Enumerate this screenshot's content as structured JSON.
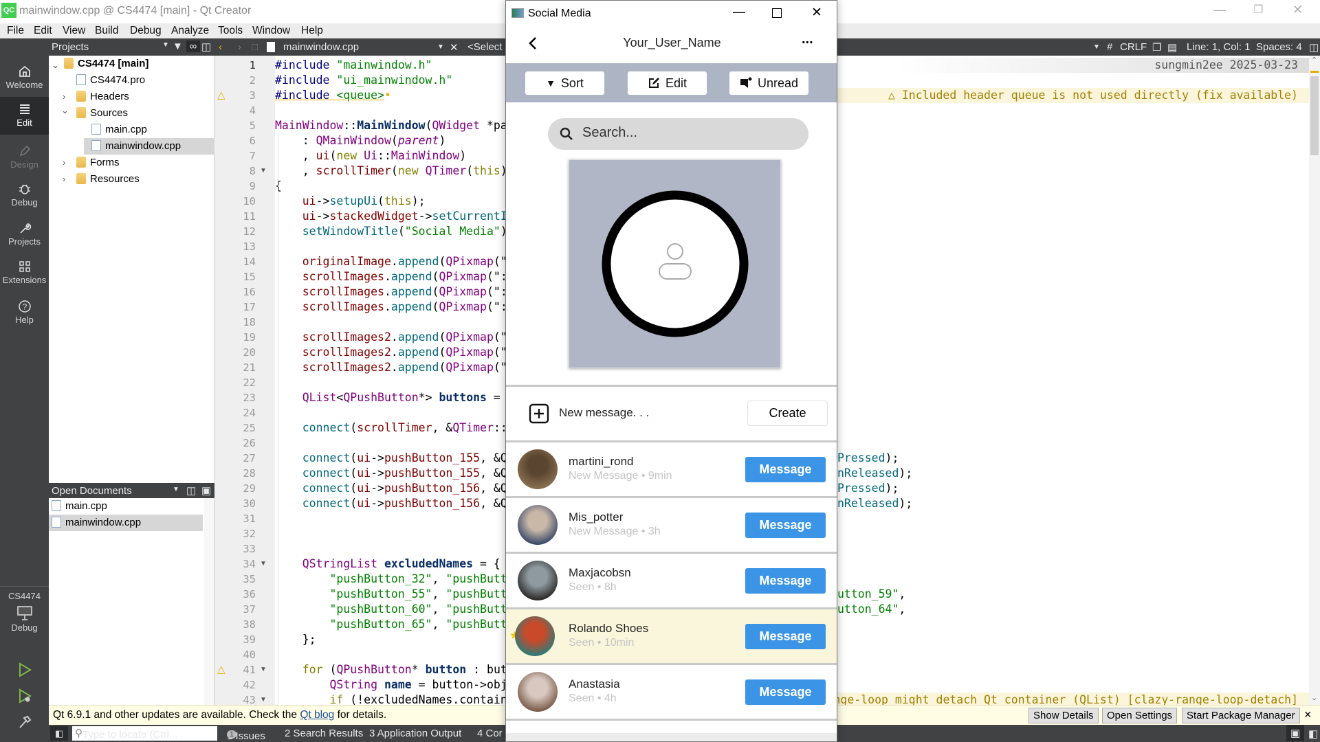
{
  "qt": {
    "window_title": "mainwindow.cpp @ CS4474 [main] - Qt Creator",
    "logo": "QC",
    "menu": [
      "File",
      "Edit",
      "View",
      "Build",
      "Debug",
      "Analyze",
      "Tools",
      "Window",
      "Help"
    ],
    "modes": {
      "welcome": "Welcome",
      "edit": "Edit",
      "design": "Design",
      "debug": "Debug",
      "projects": "Projects",
      "extensions": "Extensions",
      "help": "Help"
    },
    "kit": {
      "project": "CS4474",
      "build": "Debug"
    },
    "projects_panel": {
      "title": "Projects",
      "tree": {
        "root": "CS4474 [main]",
        "pro": "CS4474.pro",
        "headers": "Headers",
        "sources": "Sources",
        "main": "main.cpp",
        "mainwindow": "mainwindow.cpp",
        "forms": "Forms",
        "resources": "Resources"
      }
    },
    "open_documents": {
      "title": "Open Documents",
      "items": [
        "main.cpp",
        "mainwindow.cpp"
      ]
    },
    "editor_toolbar": {
      "file": "mainwindow.cpp",
      "symbol": "<Select",
      "hash": "#",
      "line_ending": "CRLF",
      "position": "Line: 1, Col: 1",
      "indent": "Spaces: 4"
    },
    "blame": "sungmin2ee 2025-03-23",
    "annotations": {
      "line3": "Included header queue is not used directly (fix available)",
      "line41": "ange-loop might detach Qt container (QList) [clazy-range-loop-detach]"
    },
    "code_lines": [
      {
        "n": "1",
        "tk": [
          [
            "p",
            "#include"
          ],
          [
            "n",
            " "
          ],
          [
            "s",
            "\"mainwindow.h\""
          ]
        ]
      },
      {
        "n": "2",
        "tk": [
          [
            "p",
            "#include"
          ],
          [
            "n",
            " "
          ],
          [
            "s",
            "\"ui_mainwindow.h\""
          ]
        ]
      },
      {
        "n": "3",
        "warn": true,
        "tk": [
          [
            "p und",
            "#include"
          ],
          [
            "n und",
            " "
          ],
          [
            "s und",
            "<queue>"
          ]
        ]
      },
      {
        "n": "4",
        "tk": []
      },
      {
        "n": "5",
        "tk": [
          [
            "t",
            "MainWindow"
          ],
          [
            "n",
            "::"
          ],
          [
            "b",
            "MainWindow"
          ],
          [
            "n",
            "("
          ],
          [
            "t",
            "QWidget"
          ],
          [
            "n",
            " *pa"
          ]
        ]
      },
      {
        "n": "6",
        "tk": [
          [
            "n",
            "    : "
          ],
          [
            "t",
            "QMainWindow"
          ],
          [
            "n",
            "("
          ],
          [
            "i",
            "parent"
          ],
          [
            "n",
            ")"
          ]
        ]
      },
      {
        "n": "7",
        "tk": [
          [
            "n",
            "    , "
          ],
          [
            "m",
            "ui"
          ],
          [
            "n",
            "("
          ],
          [
            "k",
            "new"
          ],
          [
            "n",
            " "
          ],
          [
            "t",
            "Ui"
          ],
          [
            "n",
            "::"
          ],
          [
            "t",
            "MainWindow"
          ],
          [
            "n",
            ")"
          ]
        ]
      },
      {
        "n": "8",
        "fold": true,
        "tk": [
          [
            "n",
            "    , "
          ],
          [
            "m",
            "scrollTimer"
          ],
          [
            "n",
            "("
          ],
          [
            "k",
            "new"
          ],
          [
            "n",
            " "
          ],
          [
            "t",
            "QTimer"
          ],
          [
            "n",
            "("
          ],
          [
            "k",
            "this"
          ],
          [
            "n",
            ")"
          ]
        ]
      },
      {
        "n": "9",
        "tk": [
          [
            "n",
            "{"
          ]
        ]
      },
      {
        "n": "10",
        "tk": [
          [
            "n",
            "    "
          ],
          [
            "m",
            "ui"
          ],
          [
            "n",
            "->"
          ],
          [
            "f",
            "setupUi"
          ],
          [
            "n",
            "("
          ],
          [
            "k",
            "this"
          ],
          [
            "n",
            ");"
          ]
        ]
      },
      {
        "n": "11",
        "tk": [
          [
            "n",
            "    "
          ],
          [
            "m",
            "ui"
          ],
          [
            "n",
            "->"
          ],
          [
            "m",
            "stackedWidget"
          ],
          [
            "n",
            "->"
          ],
          [
            "f",
            "setCurrentI"
          ]
        ]
      },
      {
        "n": "12",
        "tk": [
          [
            "n",
            "    "
          ],
          [
            "f",
            "setWindowTitle"
          ],
          [
            "n",
            "("
          ],
          [
            "s",
            "\"Social Media\""
          ],
          [
            "n",
            ")"
          ]
        ]
      },
      {
        "n": "13",
        "tk": []
      },
      {
        "n": "14",
        "tk": [
          [
            "n",
            "    "
          ],
          [
            "m",
            "originalImage"
          ],
          [
            "n",
            "."
          ],
          [
            "f",
            "append"
          ],
          [
            "n",
            "("
          ],
          [
            "t",
            "QPixmap"
          ],
          [
            "n",
            "(\""
          ]
        ]
      },
      {
        "n": "15",
        "tk": [
          [
            "n",
            "    "
          ],
          [
            "m",
            "scrollImages"
          ],
          [
            "n",
            "."
          ],
          [
            "f",
            "append"
          ],
          [
            "n",
            "("
          ],
          [
            "t",
            "QPixmap"
          ],
          [
            "n",
            "(\":"
          ]
        ]
      },
      {
        "n": "16",
        "tk": [
          [
            "n",
            "    "
          ],
          [
            "m",
            "scrollImages"
          ],
          [
            "n",
            "."
          ],
          [
            "f",
            "append"
          ],
          [
            "n",
            "("
          ],
          [
            "t",
            "QPixmap"
          ],
          [
            "n",
            "(\":"
          ]
        ]
      },
      {
        "n": "17",
        "tk": [
          [
            "n",
            "    "
          ],
          [
            "m",
            "scrollImages"
          ],
          [
            "n",
            "."
          ],
          [
            "f",
            "append"
          ],
          [
            "n",
            "("
          ],
          [
            "t",
            "QPixmap"
          ],
          [
            "n",
            "(\":"
          ]
        ]
      },
      {
        "n": "18",
        "tk": []
      },
      {
        "n": "19",
        "tk": [
          [
            "n",
            "    "
          ],
          [
            "m",
            "scrollImages2"
          ],
          [
            "n",
            "."
          ],
          [
            "f",
            "append"
          ],
          [
            "n",
            "("
          ],
          [
            "t",
            "QPixmap"
          ],
          [
            "n",
            "(\""
          ]
        ]
      },
      {
        "n": "20",
        "tk": [
          [
            "n",
            "    "
          ],
          [
            "m",
            "scrollImages2"
          ],
          [
            "n",
            "."
          ],
          [
            "f",
            "append"
          ],
          [
            "n",
            "("
          ],
          [
            "t",
            "QPixmap"
          ],
          [
            "n",
            "(\""
          ]
        ]
      },
      {
        "n": "21",
        "tk": [
          [
            "n",
            "    "
          ],
          [
            "m",
            "scrollImages2"
          ],
          [
            "n",
            "."
          ],
          [
            "f",
            "append"
          ],
          [
            "n",
            "("
          ],
          [
            "t",
            "QPixmap"
          ],
          [
            "n",
            "(\""
          ]
        ]
      },
      {
        "n": "22",
        "tk": []
      },
      {
        "n": "23",
        "tk": [
          [
            "n",
            "    "
          ],
          [
            "t",
            "QList"
          ],
          [
            "n",
            "<"
          ],
          [
            "t",
            "QPushButton"
          ],
          [
            "n",
            "*> "
          ],
          [
            "b",
            "buttons"
          ],
          [
            "n",
            " ="
          ]
        ]
      },
      {
        "n": "24",
        "tk": []
      },
      {
        "n": "25",
        "tk": [
          [
            "n",
            "    "
          ],
          [
            "f",
            "connect"
          ],
          [
            "n",
            "("
          ],
          [
            "m",
            "scrollTimer"
          ],
          [
            "n",
            ", &"
          ],
          [
            "t",
            "QTimer"
          ],
          [
            "n",
            "::"
          ]
        ]
      },
      {
        "n": "26",
        "tk": []
      },
      {
        "n": "27",
        "tk": [
          [
            "n",
            "    "
          ],
          [
            "f",
            "connect"
          ],
          [
            "n",
            "("
          ],
          [
            "m",
            "ui"
          ],
          [
            "n",
            "->"
          ],
          [
            "m",
            "pushButton_155"
          ],
          [
            "n",
            ", &Q"
          ]
        ]
      },
      {
        "n": "28",
        "tk": [
          [
            "n",
            "    "
          ],
          [
            "f",
            "connect"
          ],
          [
            "n",
            "("
          ],
          [
            "m",
            "ui"
          ],
          [
            "n",
            "->"
          ],
          [
            "m",
            "pushButton_155"
          ],
          [
            "n",
            ", &Q"
          ]
        ]
      },
      {
        "n": "29",
        "tk": [
          [
            "n",
            "    "
          ],
          [
            "f",
            "connect"
          ],
          [
            "n",
            "("
          ],
          [
            "m",
            "ui"
          ],
          [
            "n",
            "->"
          ],
          [
            "m",
            "pushButton_156"
          ],
          [
            "n",
            ", &Q"
          ]
        ]
      },
      {
        "n": "30",
        "tk": [
          [
            "n",
            "    "
          ],
          [
            "f",
            "connect"
          ],
          [
            "n",
            "("
          ],
          [
            "m",
            "ui"
          ],
          [
            "n",
            "->"
          ],
          [
            "m",
            "pushButton_156"
          ],
          [
            "n",
            ", &Q"
          ]
        ]
      },
      {
        "n": "31",
        "tk": []
      },
      {
        "n": "32",
        "tk": []
      },
      {
        "n": "33",
        "tk": []
      },
      {
        "n": "34",
        "fold": true,
        "tk": [
          [
            "n",
            "    "
          ],
          [
            "t",
            "QStringList"
          ],
          [
            "n",
            " "
          ],
          [
            "b",
            "excludedNames"
          ],
          [
            "n",
            " = {"
          ]
        ]
      },
      {
        "n": "35",
        "tk": [
          [
            "n",
            "        "
          ],
          [
            "s",
            "\"pushButton_32\""
          ],
          [
            "n",
            ", "
          ],
          [
            "s",
            "\"pushButt"
          ]
        ]
      },
      {
        "n": "36",
        "tk": [
          [
            "n",
            "        "
          ],
          [
            "s",
            "\"pushButton_55\""
          ],
          [
            "n",
            ", "
          ],
          [
            "s",
            "\"pushButt"
          ]
        ]
      },
      {
        "n": "37",
        "tk": [
          [
            "n",
            "        "
          ],
          [
            "s",
            "\"pushButton_60\""
          ],
          [
            "n",
            ", "
          ],
          [
            "s",
            "\"pushButt"
          ]
        ]
      },
      {
        "n": "38",
        "tk": [
          [
            "n",
            "        "
          ],
          [
            "s",
            "\"pushButton_65\""
          ],
          [
            "n",
            ", "
          ],
          [
            "s",
            "\"pushButt"
          ]
        ]
      },
      {
        "n": "39",
        "tk": [
          [
            "n",
            "    };"
          ]
        ]
      },
      {
        "n": "40",
        "tk": []
      },
      {
        "n": "41",
        "warn": true,
        "fold": true,
        "tk": [
          [
            "n",
            "    "
          ],
          [
            "k",
            "for"
          ],
          [
            "n",
            " ("
          ],
          [
            "t",
            "QPushButton"
          ],
          [
            "n",
            "* "
          ],
          [
            "b",
            "button"
          ],
          [
            "n",
            " : but"
          ]
        ]
      },
      {
        "n": "42",
        "tk": [
          [
            "n",
            "        "
          ],
          [
            "t",
            "QString"
          ],
          [
            "n",
            " "
          ],
          [
            "b",
            "name"
          ],
          [
            "n",
            " = button->obj"
          ]
        ]
      },
      {
        "n": "43",
        "fold": true,
        "tk": [
          [
            "n",
            "        "
          ],
          [
            "k",
            "if"
          ],
          [
            "n",
            " (!excludedNames.contain"
          ]
        ]
      }
    ],
    "code_tails": [
      {
        "line": 27,
        "tk": [
          [
            "f",
            "Pressed"
          ],
          [
            "n",
            ");"
          ]
        ]
      },
      {
        "line": 28,
        "tk": [
          [
            "f",
            "nReleased"
          ],
          [
            "n",
            ");"
          ]
        ]
      },
      {
        "line": 29,
        "tk": [
          [
            "f",
            "Pressed"
          ],
          [
            "n",
            ");"
          ]
        ]
      },
      {
        "line": 30,
        "tk": [
          [
            "f",
            "nReleased"
          ],
          [
            "n",
            ");"
          ]
        ]
      },
      {
        "line": 36,
        "tk": [
          [
            "s",
            "utton_59\""
          ],
          [
            "n",
            ","
          ]
        ]
      },
      {
        "line": 37,
        "tk": [
          [
            "s",
            "utton_64\""
          ],
          [
            "n",
            ","
          ]
        ]
      }
    ],
    "info_bar": {
      "text_before": "Qt 6.9.1 and other updates are available. Check the ",
      "link": "Qt blog",
      "text_after": " for details.",
      "show_details": "Show Details",
      "open_settings": "Open Settings",
      "start_pm": "Start Package Manager",
      "close": "×"
    },
    "bottom_bar": {
      "locate_placeholder": "Type to locate (Ctrl...",
      "issues": "1  Issues",
      "issues_count": "1",
      "search": "2  Search Results",
      "app_output": "3  Application Output",
      "compile": "4  Cor"
    }
  },
  "social": {
    "window_title": "Social Media",
    "username": "Your_User_Name",
    "more": "...",
    "toolbar": {
      "sort": "Sort",
      "edit": "Edit",
      "unread": "Unread"
    },
    "search_placeholder": "Search...",
    "new_message": "New message. . .",
    "create": "Create",
    "contacts": [
      {
        "name": "martini_rond",
        "status": "New Message • 9min",
        "button": "Message",
        "starred": false,
        "colors": [
          "#5a4530",
          "#8a7050"
        ]
      },
      {
        "name": "Mis_potter",
        "status": "New Message • 3h",
        "button": "Message",
        "starred": false,
        "colors": [
          "#c9b8a8",
          "#3a4a6a"
        ]
      },
      {
        "name": "Maxjacobsn",
        "status": "Seen • 8h",
        "button": "Message",
        "starred": false,
        "colors": [
          "#8f9aa0",
          "#2d2a28"
        ]
      },
      {
        "name": "Rolando Shoes",
        "status": "Seen • 10min",
        "button": "Message",
        "starred": true,
        "colors": [
          "#c94a2a",
          "#2f7a78"
        ]
      },
      {
        "name": "Anastasia",
        "status": "Seen • 4h",
        "button": "Message",
        "starred": false,
        "colors": [
          "#d8c8c0",
          "#7a5a48"
        ]
      }
    ],
    "colors": {
      "accent": "#3b94e6",
      "toolbar": "#adb4c4",
      "highlight": "#faf6dc"
    }
  }
}
